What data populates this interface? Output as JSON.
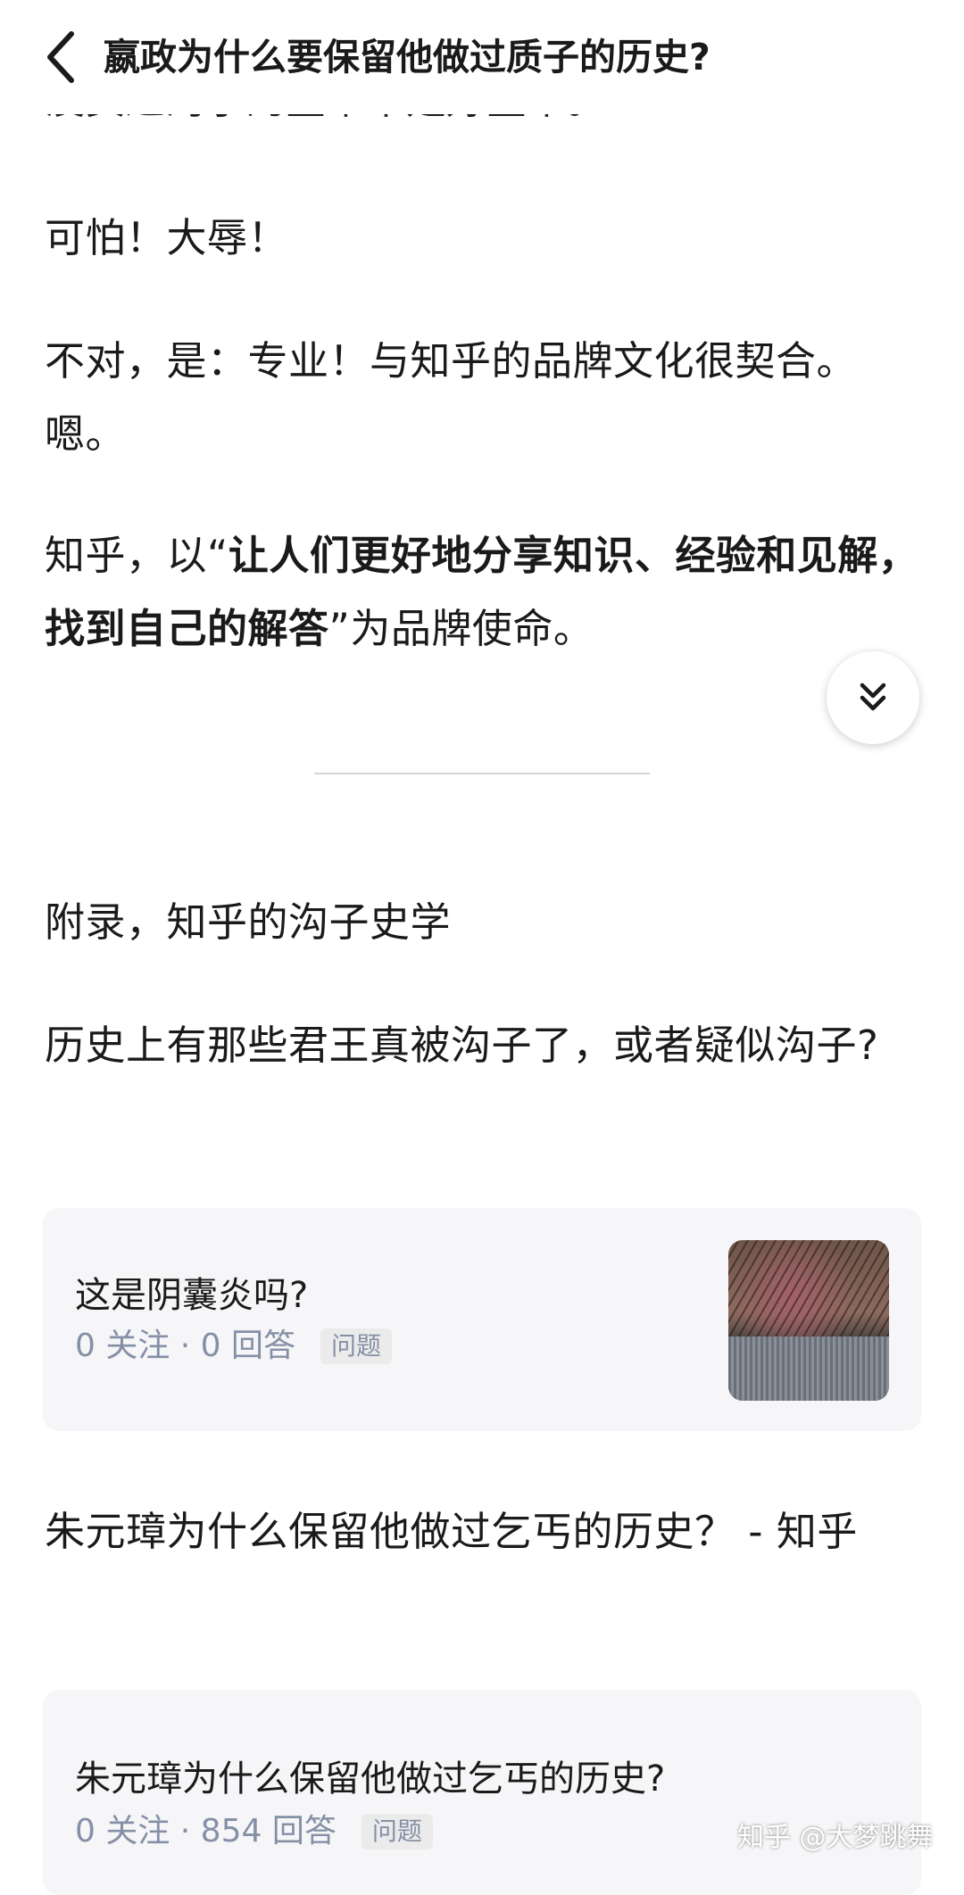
{
  "header": {
    "back_icon": "chevron-left-icon",
    "title": "嬴政为什么要保留他做过质子的历史?"
  },
  "article": {
    "clipped_line": "没卖过沟子的皇帝不是好皇帝。",
    "p1": "可怕！大辱！",
    "p2": "不对，是：专业！与知乎的品牌文化很契合。嗯。",
    "p3_prefix": "知乎，以“",
    "p3_bold": "让人们更好地分享知识、经验和见解，找到自己的解答",
    "p3_suffix": "”为品牌使命。",
    "appendix_title": "附录，知乎的沟子史学",
    "link1": "历史上有那些君王真被沟子了，或者疑似沟子?",
    "link2": "朱元璋为什么保留他做过乞丐的历史？ - 知乎"
  },
  "fab": {
    "icon": "double-chevron-down-icon"
  },
  "cards": [
    {
      "title": "这是阴囊炎吗?",
      "meta": "0 关注 · 0 回答",
      "tag": "问题",
      "has_thumbnail": true
    },
    {
      "title": "朱元璋为什么保留他做过乞丐的历史?",
      "meta": "0 关注 · 854 回答",
      "tag": "问题",
      "has_thumbnail": false
    }
  ],
  "watermark": "知乎 @大梦跳舞",
  "colors": {
    "text": "#1a1a1a",
    "meta": "#8590a6",
    "card_bg": "#f6f6f8"
  }
}
